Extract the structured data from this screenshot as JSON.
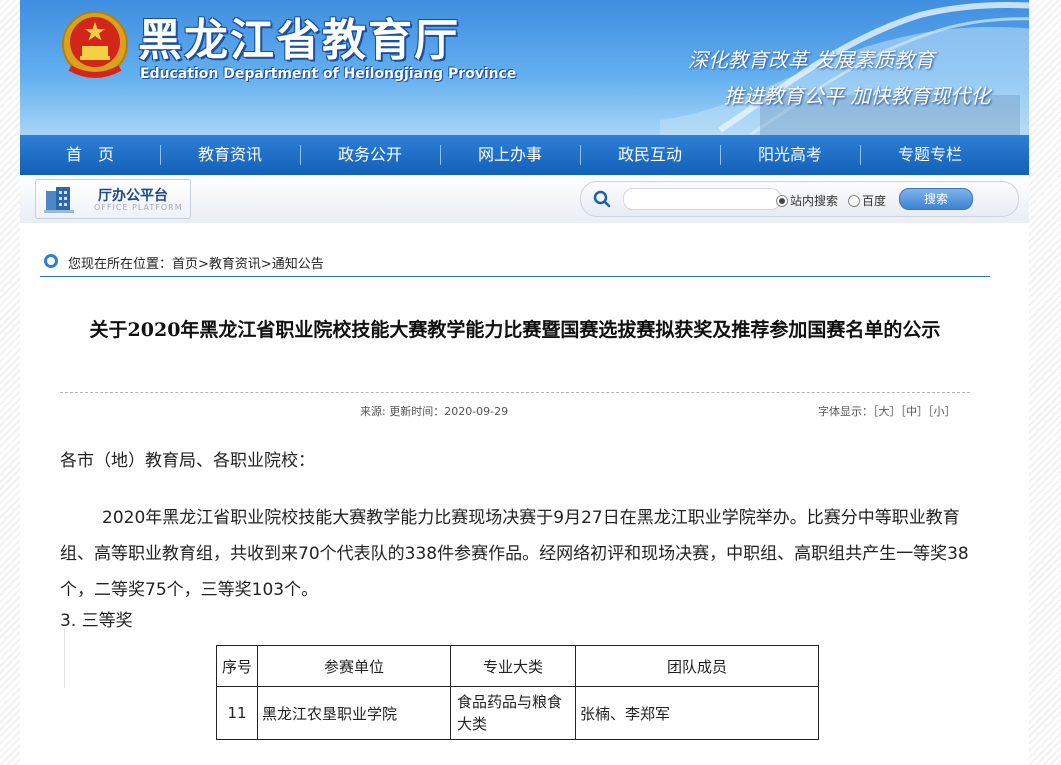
{
  "header": {
    "title_cn": "黑龙江省教育厅",
    "title_en": "Education Department of Heilongjiang Province",
    "slogan_1": "深化教育改革 发展素质教育",
    "slogan_2": "推进教育公平 加快教育现代化"
  },
  "nav": {
    "items": [
      "首　页",
      "教育资讯",
      "政务公开",
      "网上办事",
      "政民互动",
      "阳光高考",
      "专题专栏"
    ]
  },
  "toolbar": {
    "office_label": "厅办公平台",
    "office_label_en": "OFFICE PLATFORM",
    "search_placeholder": "",
    "radio_site": "站内搜索",
    "radio_baidu": "百度",
    "search_button": "搜索"
  },
  "breadcrumb": {
    "text": "您现在所在位置：首页>教育资讯>通知公告"
  },
  "article": {
    "title": "关于2020年黑龙江省职业院校技能大赛教学能力比赛暨国赛选拔赛拟获奖及推荐参加国赛名单的公示",
    "meta": "来源:  更新时间：2020-09-29",
    "font_size_label": "字体显示：［大］［中］［小］",
    "salutation": "各市（地）教育局、各职业院校：",
    "paragraph": "2020年黑龙江省职业院校技能大赛教学能力比赛现场决赛于9月27日在黑龙江职业学院举办。比赛分中等职业教育组、高等职业教育组，共收到来70个代表队的338件参赛作品。经网络初评和现场决赛，中职组、高职组共产生一等奖38个，二等奖75个，三等奖103个。",
    "section_heading": "3.  三等奖"
  },
  "table": {
    "headers": [
      "序号",
      "参赛单位",
      "专业大类",
      "团队成员"
    ],
    "rows": [
      [
        "11",
        "黑龙江农垦职业学院",
        "食品药品与粮食大类",
        "张楠、李郑军"
      ]
    ]
  }
}
